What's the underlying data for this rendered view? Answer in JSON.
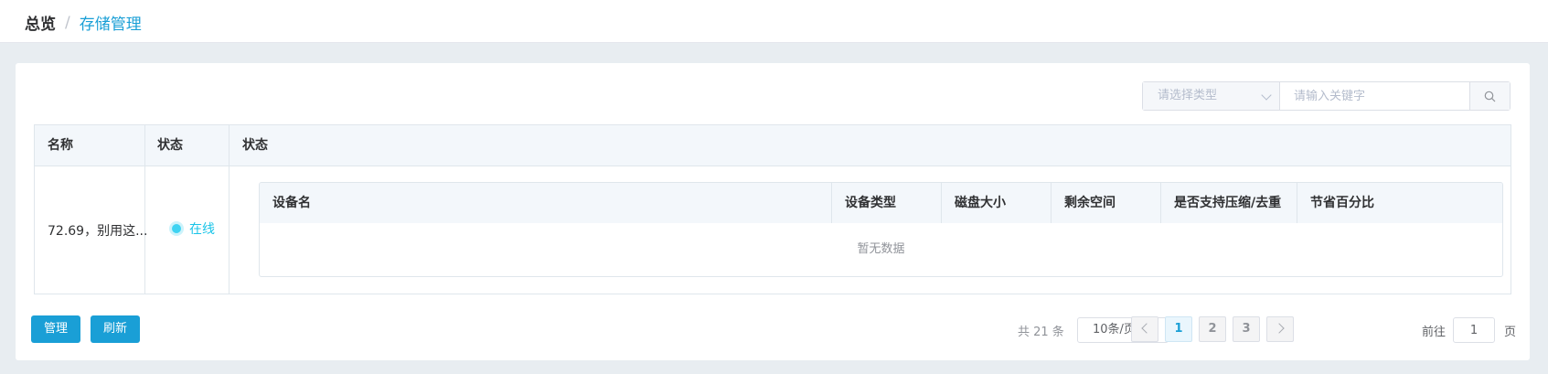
{
  "breadcrumb": {
    "home": "总览",
    "separator": "/",
    "current": "存储管理"
  },
  "filter": {
    "type_placeholder": "请选择类型",
    "keyword_placeholder": "请输入关键字",
    "search_icon": "search-icon"
  },
  "table": {
    "columns": [
      "名称",
      "状态",
      "状态"
    ],
    "rows": [
      {
        "name": "72.69，别用这...",
        "status": "在线",
        "status_color": "#1ac4e8",
        "devices": {
          "columns": [
            "设备名",
            "设备类型",
            "磁盘大小",
            "剩余空间",
            "是否支持压缩/去重",
            "节省百分比"
          ],
          "rows": [],
          "empty_text": "暂无数据"
        }
      }
    ]
  },
  "actions": {
    "manage_label": "管理",
    "refresh_label": "刷新"
  },
  "pagination": {
    "total_text": "共 21 条",
    "page_size": "10条/页",
    "pages": [
      "1",
      "2",
      "3"
    ],
    "current_page": "1",
    "goto_label": "前往",
    "goto_value": "1",
    "goto_suffix": "页"
  },
  "colors": {
    "accent": "#1a9fd6",
    "online": "#1ac4e8",
    "background": "#e8edf1"
  }
}
